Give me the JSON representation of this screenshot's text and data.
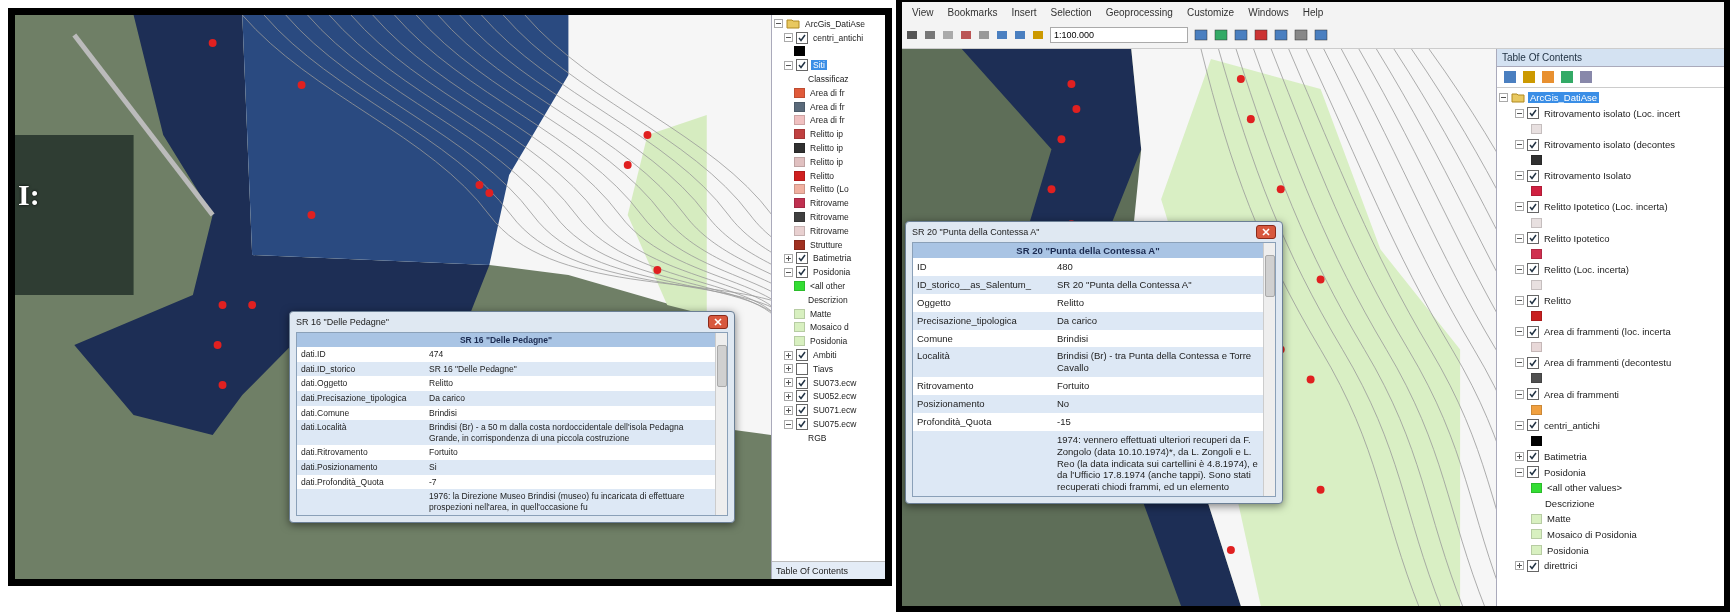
{
  "slide_heading": "I:",
  "left_window": {
    "popup": {
      "title": "SR 16 \"Delle Pedagne\"",
      "header": "SR 16 \"Delle Pedagne\"",
      "rows": [
        {
          "label": "dati.ID",
          "value": "474"
        },
        {
          "label": "dati.ID_storico",
          "value": "SR 16 \"Delle Pedagne\""
        },
        {
          "label": "dati.Oggetto",
          "value": "Relitto"
        },
        {
          "label": "dati.Precisazione_tipologica",
          "value": "Da carico"
        },
        {
          "label": "dati.Comune",
          "value": "Brindisi"
        },
        {
          "label": "dati.Località",
          "value": "Brindisi (Br) - a 50 m dalla costa nordoccidentale dell'isola Pedagna Grande, in corrispondenza di una piccola costruzione"
        },
        {
          "label": "dati.Ritrovamento",
          "value": "Fortuito"
        },
        {
          "label": "dati.Posizionamento",
          "value": "Si"
        },
        {
          "label": "dati.Profondità_Quota",
          "value": "-7"
        },
        {
          "value": "1976: la Direzione Museo Brindisi (museo) fu incaricata di effettuare prospezioni nell'area, in quell'occasione fu"
        }
      ]
    },
    "toc": {
      "items": [
        {
          "kind": "root",
          "label": "ArcGis_DatiAse",
          "selected": false,
          "expanded": true,
          "children": [
            {
              "kind": "layer",
              "label": "centri_antichi",
              "checked": true,
              "selected": false,
              "expanded": true,
              "children": [
                {
                  "kind": "legend",
                  "color": "#000000"
                }
              ]
            },
            {
              "kind": "layer",
              "label": "Siti",
              "checked": true,
              "selected": true,
              "expanded": true,
              "children": [
                {
                  "kind": "heading",
                  "label": "Classificaz"
                },
                {
                  "kind": "legend",
                  "label": "Area di fr",
                  "color": "#e05a3a"
                },
                {
                  "kind": "legend",
                  "label": "Area di fr",
                  "color": "#5a6a7a"
                },
                {
                  "kind": "legend",
                  "label": "Area di fr",
                  "color": "#f0c0c0"
                },
                {
                  "kind": "legend",
                  "label": "Relitto ip",
                  "color": "#c04040"
                },
                {
                  "kind": "legend",
                  "label": "Relitto ip",
                  "color": "#303030"
                },
                {
                  "kind": "legend",
                  "label": "Relitto ip",
                  "color": "#e0c0c0"
                },
                {
                  "kind": "legend",
                  "label": "Relitto",
                  "color": "#d02020"
                },
                {
                  "kind": "legend",
                  "label": "Relitto (Lo",
                  "color": "#f0b0a0"
                },
                {
                  "kind": "legend",
                  "label": "Ritrovame",
                  "color": "#c03050"
                },
                {
                  "kind": "legend",
                  "label": "Ritrovame",
                  "color": "#404040"
                },
                {
                  "kind": "legend",
                  "label": "Ritrovame",
                  "color": "#e8d0d0"
                },
                {
                  "kind": "legend",
                  "label": "Strutture",
                  "color": "#a03020"
                }
              ]
            },
            {
              "kind": "layer",
              "label": "Batimetria",
              "checked": true,
              "selected": false,
              "expanded": false
            },
            {
              "kind": "layer",
              "label": "Posidonia",
              "checked": true,
              "selected": false,
              "expanded": true,
              "children": [
                {
                  "kind": "legend",
                  "label": "<all other",
                  "color": "#33dd33"
                },
                {
                  "kind": "heading",
                  "label": "Descrizion"
                },
                {
                  "kind": "legend",
                  "label": "Matte",
                  "color": "#d8f0c0"
                },
                {
                  "kind": "legend",
                  "label": "Mosaico d",
                  "color": "#d8f0c0"
                },
                {
                  "kind": "legend",
                  "label": "Posidonia",
                  "color": "#d8f0c0"
                }
              ]
            },
            {
              "kind": "layer",
              "label": "Ambiti",
              "checked": true,
              "selected": false,
              "expanded": false
            },
            {
              "kind": "layer",
              "label": "Tiavs",
              "checked": false,
              "selected": false,
              "expanded": false
            },
            {
              "kind": "layer",
              "label": "SU073.ecw",
              "checked": true,
              "selected": false,
              "expanded": false
            },
            {
              "kind": "layer",
              "label": "SU052.ecw",
              "checked": true,
              "selected": false,
              "expanded": false
            },
            {
              "kind": "layer",
              "label": "SU071.ecw",
              "checked": true,
              "selected": false,
              "expanded": false
            },
            {
              "kind": "layer",
              "label": "SU075.ecw",
              "checked": true,
              "selected": false,
              "expanded": true,
              "children": [
                {
                  "kind": "heading",
                  "label": "RGB"
                }
              ]
            }
          ]
        }
      ],
      "tab": "Table Of Contents"
    }
  },
  "right_window": {
    "menu": [
      "View",
      "Bookmarks",
      "Insert",
      "Selection",
      "Geoprocessing",
      "Customize",
      "Windows",
      "Help"
    ],
    "scale": "1:100.000",
    "popup": {
      "title": "SR 20 \"Punta della Contessa A\"",
      "header": "SR 20 \"Punta della Contessa A\"",
      "rows": [
        {
          "label": "ID",
          "value": "480"
        },
        {
          "label": "ID_storico__as_Salentum_",
          "value": "SR 20 \"Punta della Contessa A\""
        },
        {
          "label": "Oggetto",
          "value": "Relitto"
        },
        {
          "label": "Precisazione_tipologica",
          "value": "Da carico"
        },
        {
          "label": "Comune",
          "value": "Brindisi"
        },
        {
          "label": "Località",
          "value": "Brindisi (Br) - tra Punta della Contessa e Torre Cavallo"
        },
        {
          "label": "Ritrovamento",
          "value": "Fortuito"
        },
        {
          "label": "Posizionamento",
          "value": "No"
        },
        {
          "label": "Profondità_Quota",
          "value": "-15"
        },
        {
          "value": "1974: vennero effettuati ulteriori recuperi da F. Zongolo (data 10.10.1974)*, da L. Zongoli e L. Reo (la data indicata sui cartellini è 4.8.1974), e da l'Ufficio 17.8.1974 (anche tappi). Sono stati recuperati chiodi frammi, ed un elemento"
        }
      ]
    },
    "toc": {
      "title": "Table Of Contents",
      "items": [
        {
          "kind": "root",
          "label": "ArcGis_DatiAse",
          "selected": true,
          "expanded": true,
          "children": [
            {
              "kind": "layer",
              "label": "Ritrovamento isolato (Loc. incert",
              "checked": true,
              "selected": false,
              "expanded": true,
              "children": [
                {
                  "kind": "legend",
                  "color": "#e8e0e0"
                }
              ]
            },
            {
              "kind": "layer",
              "label": "Ritrovamento isolato (decontes",
              "checked": true,
              "selected": false,
              "expanded": true,
              "children": [
                {
                  "kind": "legend",
                  "color": "#303030"
                }
              ]
            },
            {
              "kind": "layer",
              "label": "Ritrovamento Isolato",
              "checked": true,
              "selected": false,
              "expanded": true,
              "children": [
                {
                  "kind": "legend",
                  "color": "#d02040"
                }
              ]
            },
            {
              "kind": "layer",
              "label": "Relitto Ipotetico (Loc. incerta)",
              "checked": true,
              "selected": false,
              "expanded": true,
              "children": [
                {
                  "kind": "legend",
                  "color": "#e8e0e0"
                }
              ]
            },
            {
              "kind": "layer",
              "label": "Relitto Ipotetico",
              "checked": true,
              "selected": false,
              "expanded": true,
              "children": [
                {
                  "kind": "legend",
                  "color": "#d03050"
                }
              ]
            },
            {
              "kind": "layer",
              "label": "Relitto (Loc. incerta)",
              "checked": true,
              "selected": false,
              "expanded": true,
              "children": [
                {
                  "kind": "legend",
                  "color": "#e8e0e0"
                }
              ]
            },
            {
              "kind": "layer",
              "label": "Relitto",
              "checked": true,
              "selected": false,
              "expanded": true,
              "children": [
                {
                  "kind": "legend",
                  "color": "#c82020"
                }
              ]
            },
            {
              "kind": "layer",
              "label": "Area di frammenti (loc. incerta",
              "checked": true,
              "selected": false,
              "expanded": true,
              "children": [
                {
                  "kind": "legend",
                  "color": "#e8d8d8"
                }
              ]
            },
            {
              "kind": "layer",
              "label": "Area di frammenti (decontestu",
              "checked": true,
              "selected": false,
              "expanded": true,
              "children": [
                {
                  "kind": "legend",
                  "color": "#505050"
                }
              ]
            },
            {
              "kind": "layer",
              "label": "Area di frammenti",
              "checked": true,
              "selected": false,
              "expanded": true,
              "children": [
                {
                  "kind": "legend",
                  "color": "#f0a040"
                }
              ]
            },
            {
              "kind": "layer",
              "label": "centri_antichi",
              "checked": true,
              "selected": false,
              "expanded": true,
              "children": [
                {
                  "kind": "legend",
                  "color": "#000000"
                }
              ]
            },
            {
              "kind": "layer",
              "label": "Batimetria",
              "checked": true,
              "selected": false,
              "expanded": false
            },
            {
              "kind": "layer",
              "label": "Posidonia",
              "checked": true,
              "selected": false,
              "expanded": true,
              "children": [
                {
                  "kind": "legend",
                  "label": "<all other values>",
                  "color": "#33dd33"
                },
                {
                  "kind": "heading",
                  "label": "Descrizione"
                },
                {
                  "kind": "legend",
                  "label": "Matte",
                  "color": "#d8f0c0"
                },
                {
                  "kind": "legend",
                  "label": "Mosaico di Posidonia",
                  "color": "#d8f0c0"
                },
                {
                  "kind": "legend",
                  "label": "Posidonia",
                  "color": "#d8f0c0"
                }
              ]
            },
            {
              "kind": "layer",
              "label": "direttrici",
              "checked": true,
              "selected": false,
              "expanded": false
            }
          ]
        }
      ]
    }
  }
}
